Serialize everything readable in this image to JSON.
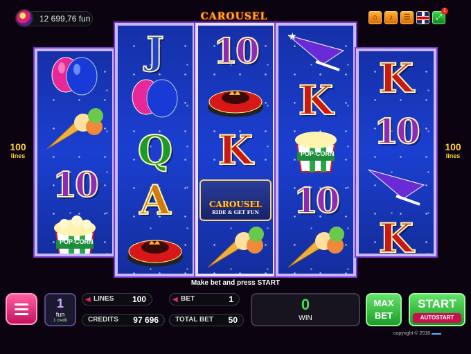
{
  "header": {
    "balance": "12 699,76 fun",
    "title": "CAROUSEL",
    "notification_count": "1",
    "icons": [
      "home-icon",
      "sound-icon",
      "paytable-icon",
      "language-flag-icon",
      "fullscreen-icon"
    ]
  },
  "lines_indicator": {
    "value": "100",
    "unit": "lines"
  },
  "reels": [
    {
      "symbols": [
        "balloons",
        "ice-cream",
        "10",
        "popcorn"
      ]
    },
    {
      "symbols": [
        "J",
        "balloons",
        "Q",
        "A",
        "bumper-car"
      ]
    },
    {
      "symbols": [
        "10",
        "bumper-car",
        "K",
        "carousel-wild",
        "ice-cream"
      ]
    },
    {
      "symbols": [
        "party-hat",
        "K",
        "popcorn",
        "10",
        "ice-cream"
      ]
    },
    {
      "symbols": [
        "K",
        "10",
        "party-hat",
        "K"
      ]
    }
  ],
  "wild_badge": {
    "main": "CAROUSEL",
    "sub": "RIDE & GET FUN"
  },
  "popcorn_label": "POP-CORN",
  "message": "Make bet and press START",
  "controls": {
    "credit_value": "1",
    "credit_currency": "fun",
    "credit_note": "1 credit",
    "lines_label": "LINES",
    "lines_value": "100",
    "bet_label": "BET",
    "bet_value": "1",
    "credits_label": "CREDITS",
    "credits_value": "97 696",
    "total_bet_label": "TOTAL BET",
    "total_bet_value": "50",
    "win_value": "0",
    "win_label": "WIN",
    "max_bet_label": "MAX BET",
    "start_label": "START",
    "autostart_label": "AUTOSTART"
  },
  "copyright": "copyright © 2018",
  "colors": {
    "reel_bg": "#1b3fd0",
    "frame": "#c9b7ff",
    "accent_pink": "#e22a6b",
    "start_green": "#1a9a24",
    "win_green": "#3fe04a",
    "title_orange": "#ffb020"
  }
}
